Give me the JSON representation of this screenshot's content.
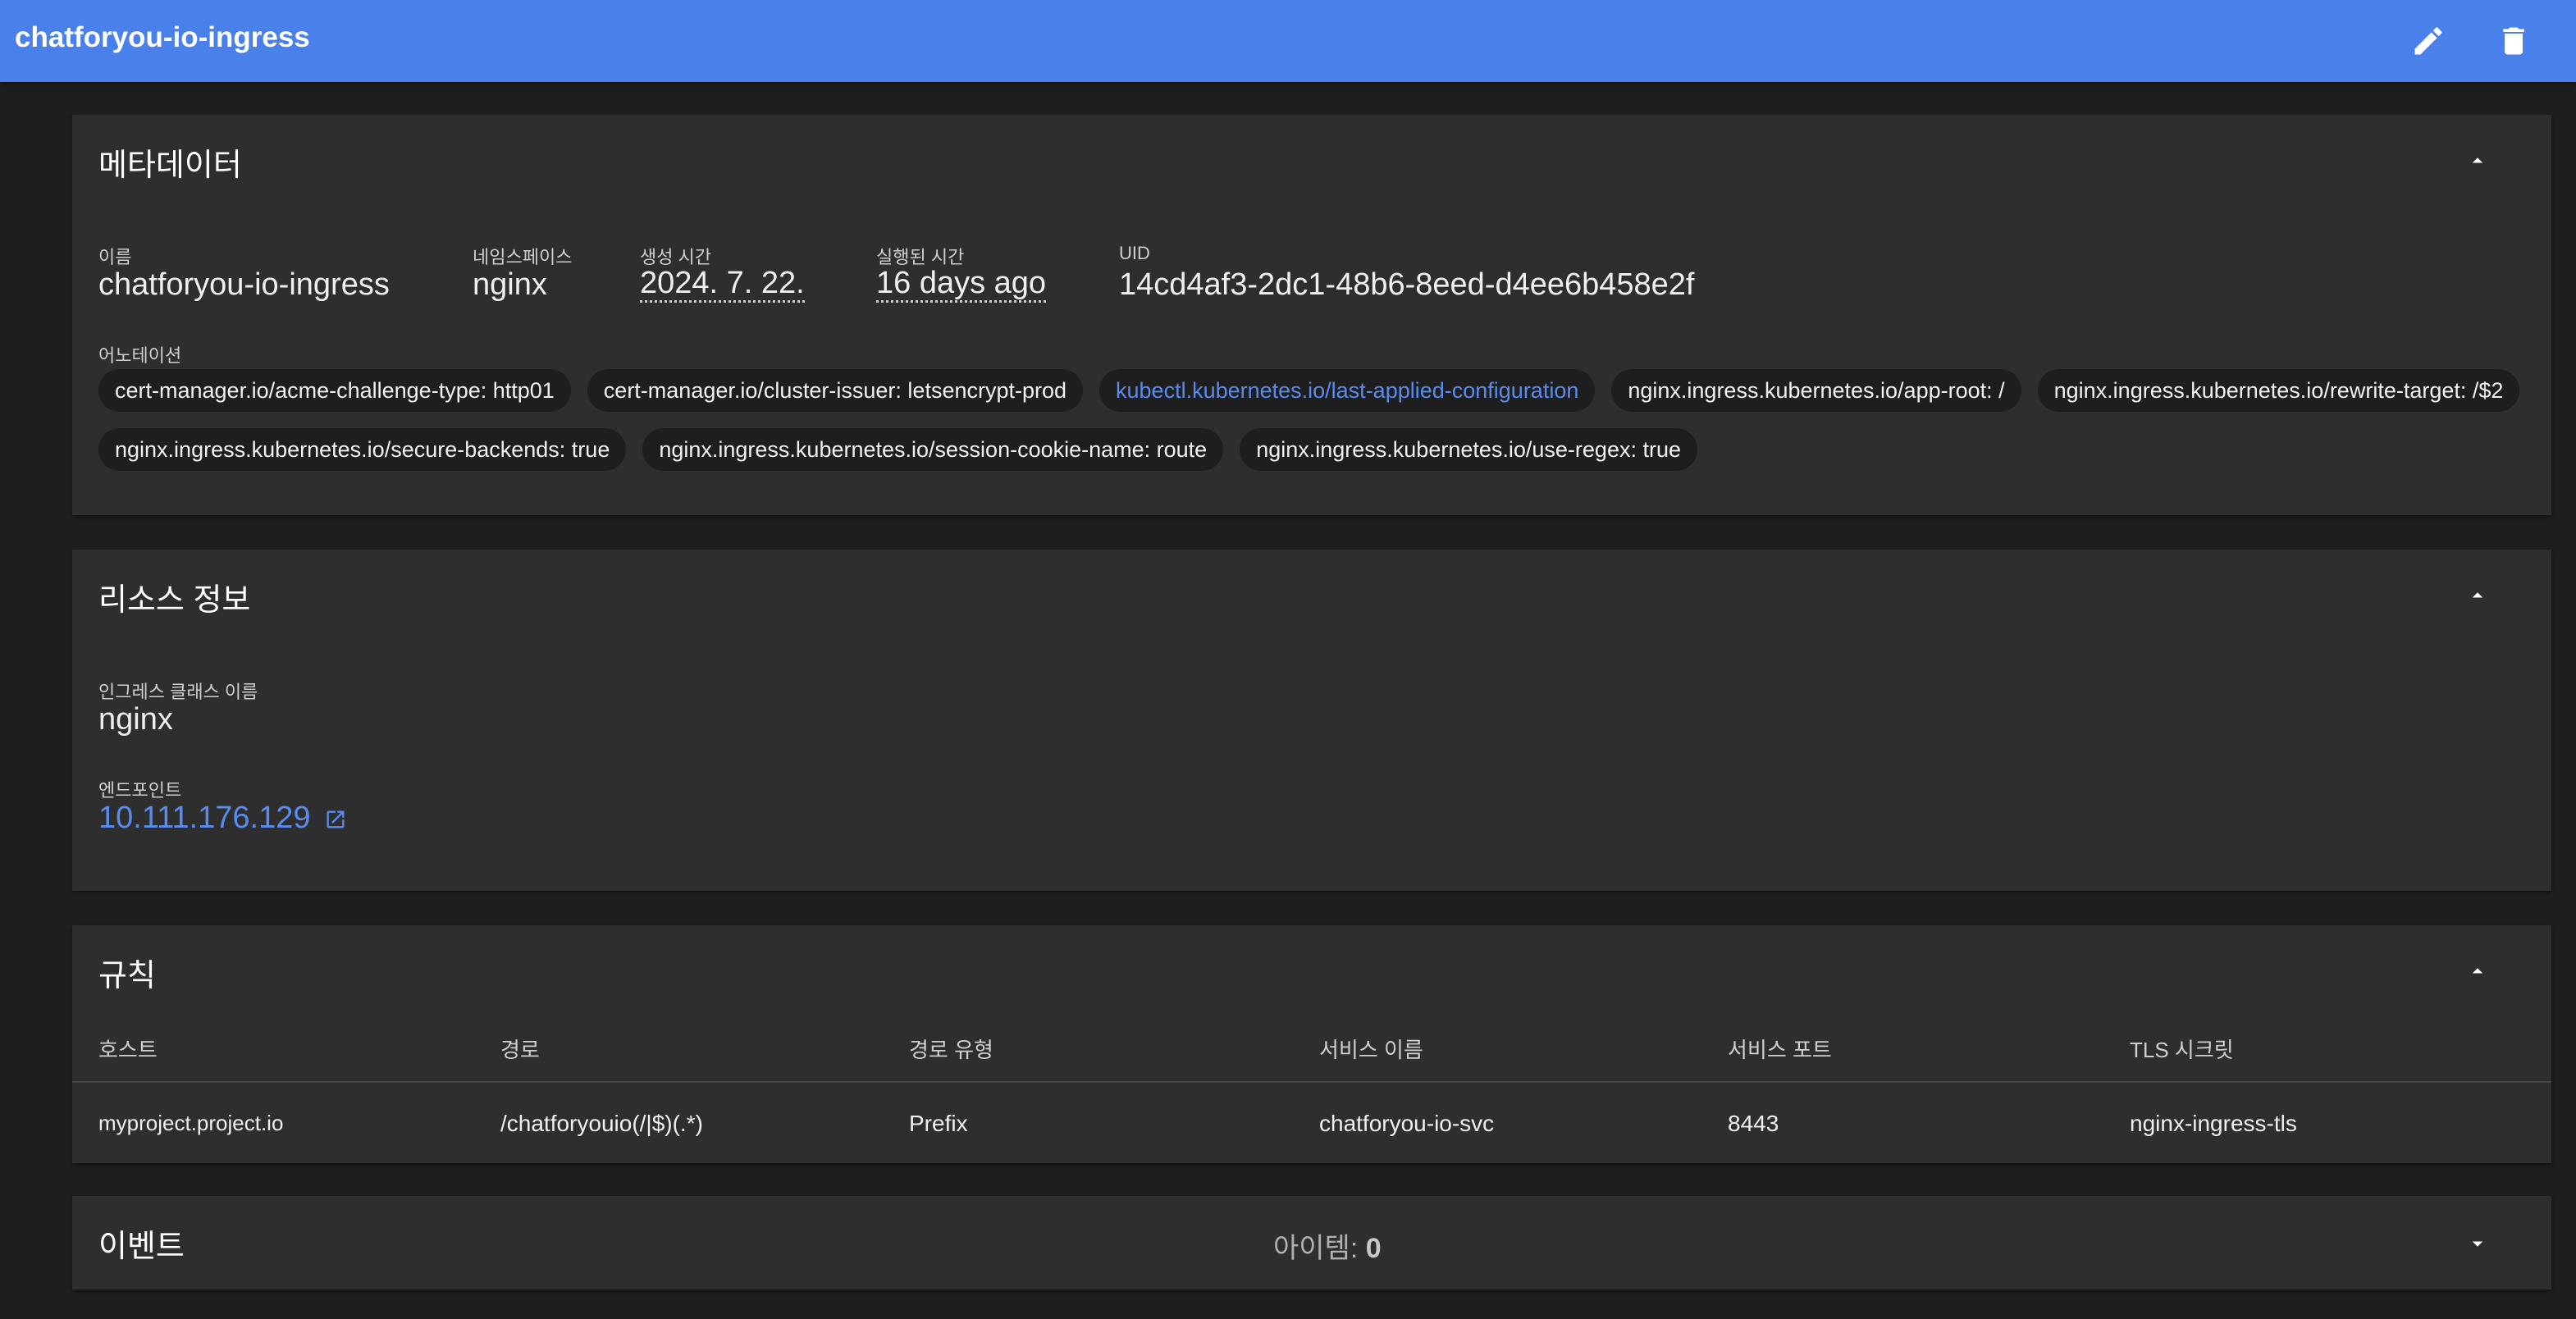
{
  "header": {
    "title": "chatforyou-io-ingress",
    "edit_icon": "pencil-icon",
    "delete_icon": "trash-icon"
  },
  "metadata": {
    "title": "메타데이터",
    "fields": {
      "name_label": "이름",
      "name": "chatforyou-io-ingress",
      "namespace_label": "네임스페이스",
      "namespace": "nginx",
      "created_label": "생성 시간",
      "created": "2024. 7. 22.",
      "age_label": "실행된 시간",
      "age": "16 days ago",
      "uid_label": "UID",
      "uid": "14cd4af3-2dc1-48b6-8eed-d4ee6b458e2f"
    },
    "annotations_label": "어노테이션",
    "annotations": [
      "cert-manager.io/acme-challenge-type: http01",
      "cert-manager.io/cluster-issuer: letsencrypt-prod",
      "kubectl.kubernetes.io/last-applied-configuration",
      "nginx.ingress.kubernetes.io/app-root: /",
      "nginx.ingress.kubernetes.io/rewrite-target: /$2",
      "nginx.ingress.kubernetes.io/secure-backends: true",
      "nginx.ingress.kubernetes.io/session-cookie-name: route",
      "nginx.ingress.kubernetes.io/use-regex: true"
    ]
  },
  "resource": {
    "title": "리소스 정보",
    "class_label": "인그레스 클래스 이름",
    "class_name": "nginx",
    "endpoint_label": "엔드포인트",
    "endpoint": "10.111.176.129"
  },
  "rules": {
    "title": "규칙",
    "columns": [
      "호스트",
      "경로",
      "경로 유형",
      "서비스 이름",
      "서비스 포트",
      "TLS 시크릿"
    ],
    "rows": [
      {
        "host": "myproject.project.io",
        "path": "/chatforyouio(/|$)(.*)",
        "path_type": "Prefix",
        "service": "chatforyou-io-svc",
        "port": "8443",
        "tls": "nginx-ingress-tls"
      }
    ]
  },
  "events": {
    "title": "이벤트",
    "items_label": "아이템:",
    "items_count": "0"
  },
  "colors": {
    "toolbar": "#4a80ea",
    "link": "#5a8cf0",
    "card": "#2e2e2e",
    "background": "#1e1e1e"
  }
}
